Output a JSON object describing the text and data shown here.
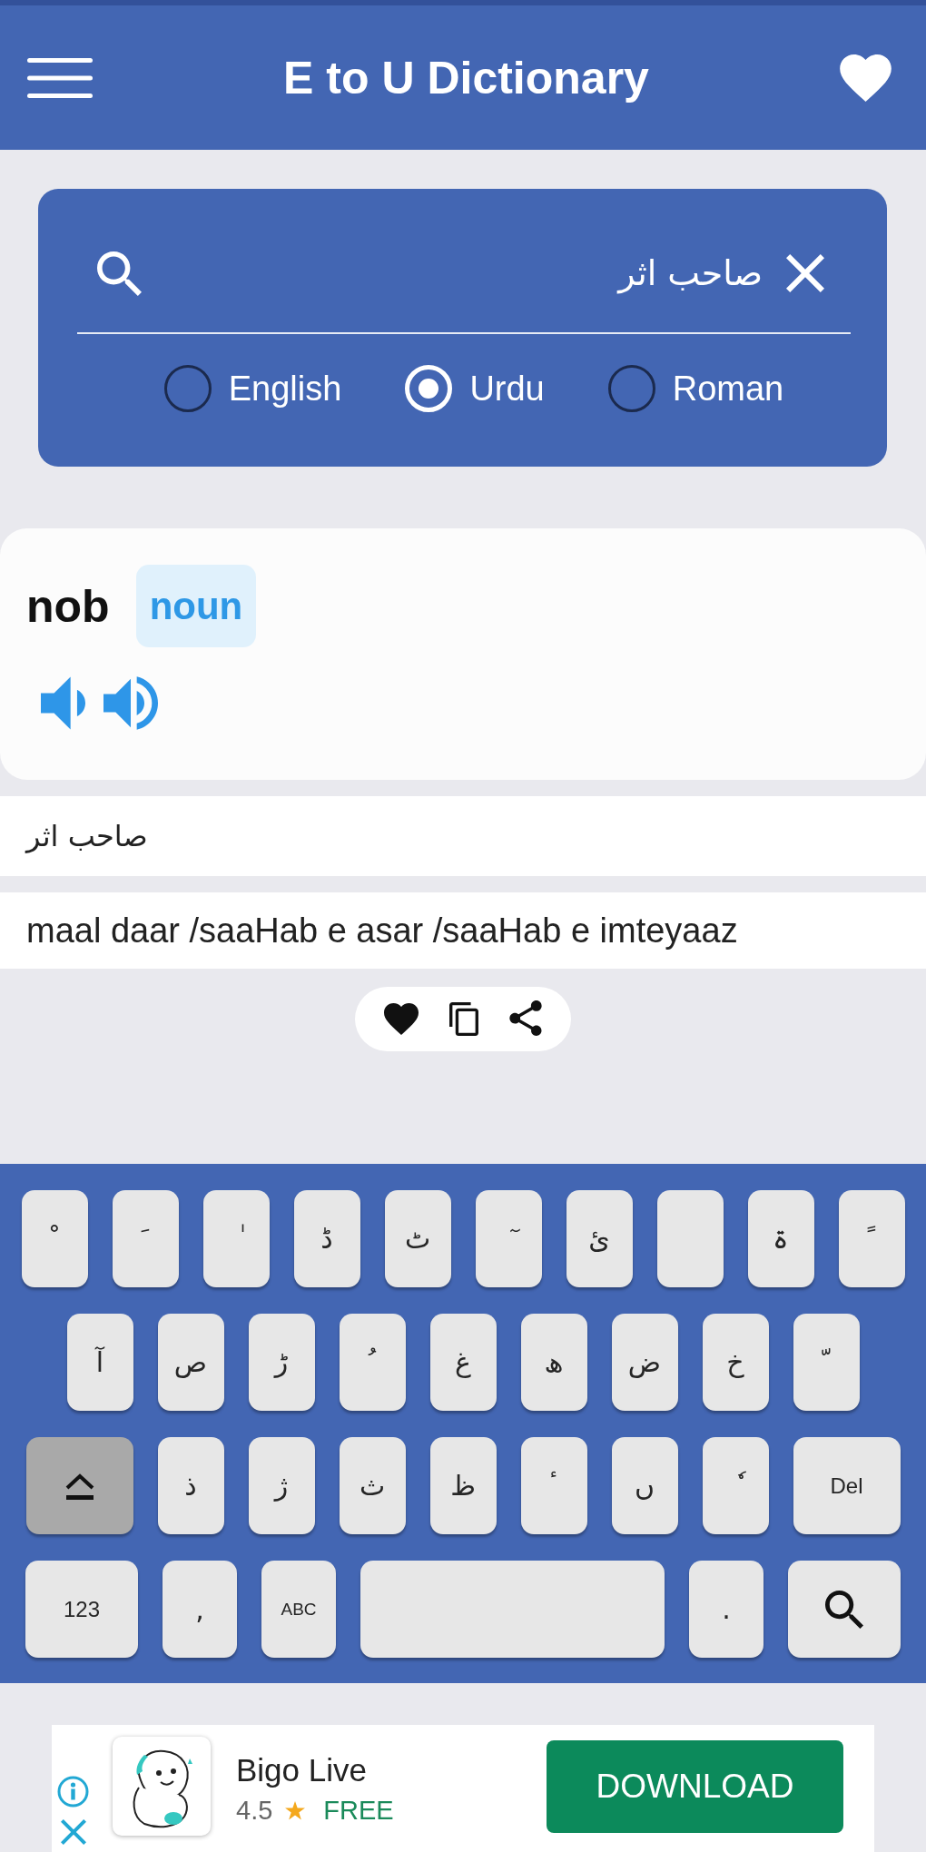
{
  "app_bar": {
    "title": "E to U Dictionary"
  },
  "search": {
    "value": "صاحب اثر",
    "languages": [
      {
        "label": "English",
        "selected": false
      },
      {
        "label": "Urdu",
        "selected": true
      },
      {
        "label": "Roman",
        "selected": false
      }
    ]
  },
  "entry": {
    "word": "nob",
    "part_of_speech": "noun",
    "urdu_meaning": "صاحب اثر",
    "roman_meaning": "maal daar /saaHab e asar /saaHab e imteyaaz"
  },
  "keyboard": {
    "rows": [
      [
        {
          "kind": "char",
          "label": "ﹾ"
        },
        {
          "kind": "char",
          "label": "ﹶ"
        },
        {
          "kind": "char",
          "label": "ٰ"
        },
        {
          "kind": "char",
          "label": "ڈ"
        },
        {
          "kind": "char",
          "label": "ٹ"
        },
        {
          "kind": "char",
          "label": "ٓ"
        },
        {
          "kind": "char",
          "label": "ئ"
        },
        {
          "kind": "blank"
        },
        {
          "kind": "char",
          "label": "ۃ"
        },
        {
          "kind": "char",
          "label": "ﹰ"
        }
      ],
      [
        {
          "kind": "char",
          "label": "آ"
        },
        {
          "kind": "char",
          "label": "ص"
        },
        {
          "kind": "char",
          "label": "ڑ"
        },
        {
          "kind": "char",
          "label": "ﹸ"
        },
        {
          "kind": "char",
          "label": "غ"
        },
        {
          "kind": "char",
          "label": "ھ"
        },
        {
          "kind": "char",
          "label": "ض"
        },
        {
          "kind": "char",
          "label": "خ"
        },
        {
          "kind": "char",
          "label": "ﹼ"
        }
      ],
      [
        {
          "kind": "shift"
        },
        {
          "kind": "char",
          "label": "ذ"
        },
        {
          "kind": "char",
          "label": "ژ"
        },
        {
          "kind": "char",
          "label": "ث"
        },
        {
          "kind": "char",
          "label": "ظ"
        },
        {
          "kind": "char",
          "label": "ٴ"
        },
        {
          "kind": "char",
          "label": "ں"
        },
        {
          "kind": "char",
          "label": "ٗ"
        },
        {
          "kind": "wide_text",
          "label": "Del"
        }
      ],
      [
        {
          "kind": "wide_text",
          "label": "123"
        },
        {
          "kind": "char",
          "label": ","
        },
        {
          "kind": "text",
          "label": "ABC"
        },
        {
          "kind": "space"
        },
        {
          "kind": "char",
          "label": "."
        },
        {
          "kind": "search"
        }
      ]
    ]
  },
  "ad": {
    "app_name": "Bigo Live",
    "rating": "4.5",
    "price": "FREE",
    "action": "DOWNLOAD"
  }
}
